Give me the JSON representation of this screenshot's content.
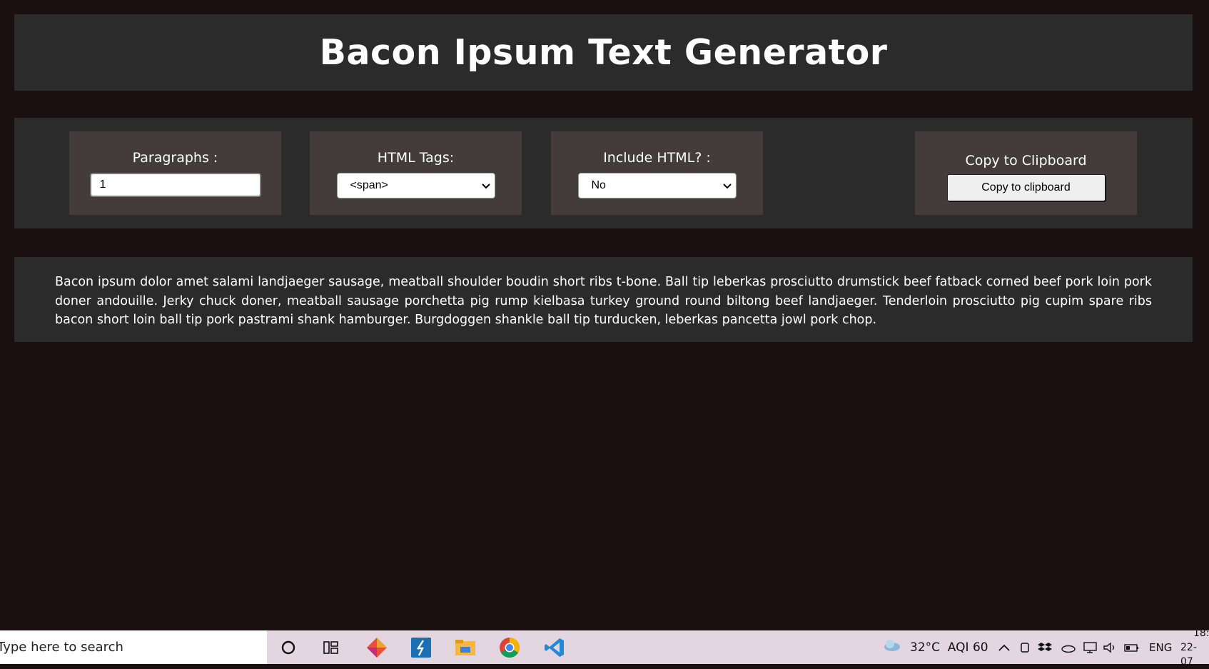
{
  "header": {
    "title": "Bacon Ipsum Text Generator"
  },
  "controls": {
    "paragraphs": {
      "label": "Paragraphs :",
      "value": "1"
    },
    "html_tags": {
      "label": "HTML Tags:",
      "selected": "<span>"
    },
    "include_html": {
      "label": "Include HTML? :",
      "selected": "No"
    },
    "copy": {
      "label": "Copy to Clipboard",
      "button": "Copy to clipboard"
    }
  },
  "output": {
    "text": "Bacon ipsum dolor amet salami landjaeger sausage, meatball shoulder boudin short ribs t-bone. Ball tip leberkas prosciutto drumstick beef fatback corned beef pork loin pork doner andouille. Jerky chuck doner, meatball sausage porchetta pig rump kielbasa turkey ground round biltong beef landjaeger. Tenderloin prosciutto pig cupim spare ribs bacon short loin ball tip pork pastrami shank hamburger. Burgdoggen shankle ball tip turducken, leberkas pancetta jowl pork chop."
  },
  "taskbar": {
    "search_placeholder": "Type here to search",
    "weather": "32°C  AQI 60",
    "language": "ENG",
    "time": "18:",
    "date": "22-07",
    "apps": [
      "cortana-icon",
      "task-view-icon",
      "git-app-icon",
      "dev-app-icon",
      "file-explorer-icon",
      "chrome-icon",
      "vscode-icon"
    ]
  },
  "colors": {
    "background": "#1a1011",
    "panel": "#2b2b2b",
    "control_card": "#433c3b",
    "taskbar": "#e3d6e0"
  }
}
